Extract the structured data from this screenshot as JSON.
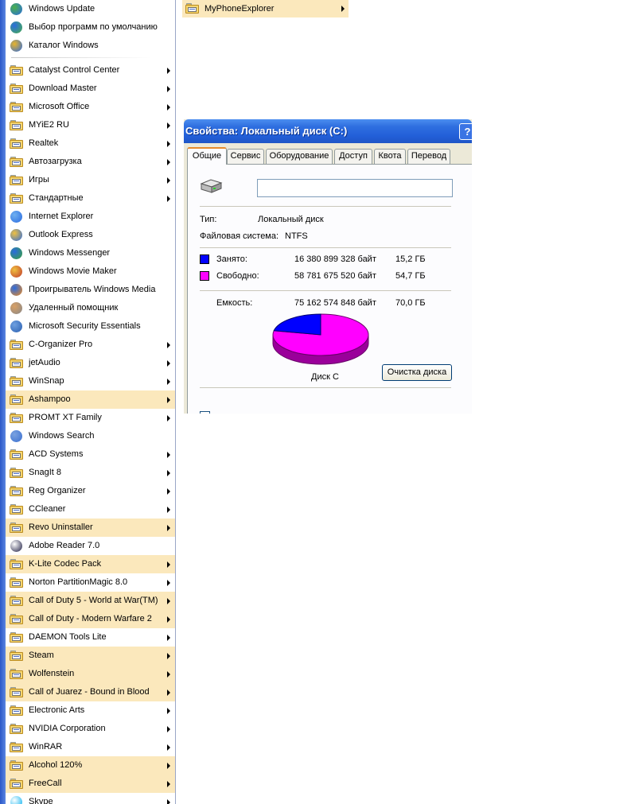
{
  "programs_menu": {
    "items": [
      {
        "label": "Windows Update",
        "icon": "windows-update-icon",
        "submenu": false,
        "highlighted": false
      },
      {
        "label": "Выбор программ по умолчанию",
        "icon": "default-programs-icon",
        "submenu": false,
        "highlighted": false
      },
      {
        "label": "Каталог Windows",
        "icon": "windows-catalog-icon",
        "submenu": false,
        "highlighted": false
      },
      {
        "label": "Catalyst Control Center",
        "icon": "folder-icon",
        "submenu": true,
        "highlighted": false
      },
      {
        "label": "Download Master",
        "icon": "folder-icon",
        "submenu": true,
        "highlighted": false
      },
      {
        "label": "Microsoft Office",
        "icon": "folder-icon",
        "submenu": true,
        "highlighted": false
      },
      {
        "label": "MYiE2 RU",
        "icon": "folder-icon",
        "submenu": true,
        "highlighted": false
      },
      {
        "label": "Realtek",
        "icon": "folder-icon",
        "submenu": true,
        "highlighted": false
      },
      {
        "label": "Автозагрузка",
        "icon": "folder-icon",
        "submenu": true,
        "highlighted": false
      },
      {
        "label": "Игры",
        "icon": "folder-icon",
        "submenu": true,
        "highlighted": false
      },
      {
        "label": "Стандартные",
        "icon": "folder-icon",
        "submenu": true,
        "highlighted": false
      },
      {
        "label": "Internet Explorer",
        "icon": "internet-explorer-icon",
        "submenu": false,
        "highlighted": false
      },
      {
        "label": "Outlook Express",
        "icon": "outlook-express-icon",
        "submenu": false,
        "highlighted": false
      },
      {
        "label": "Windows Messenger",
        "icon": "windows-messenger-icon",
        "submenu": false,
        "highlighted": false
      },
      {
        "label": "Windows Movie Maker",
        "icon": "movie-maker-icon",
        "submenu": false,
        "highlighted": false
      },
      {
        "label": "Проигрыватель Windows Media",
        "icon": "media-player-icon",
        "submenu": false,
        "highlighted": false
      },
      {
        "label": "Удаленный помощник",
        "icon": "remote-assistance-icon",
        "submenu": false,
        "highlighted": false
      },
      {
        "label": "Microsoft Security Essentials",
        "icon": "security-essentials-icon",
        "submenu": false,
        "highlighted": false
      },
      {
        "label": "C-Organizer Pro",
        "icon": "folder-icon",
        "submenu": true,
        "highlighted": false
      },
      {
        "label": "jetAudio",
        "icon": "folder-icon",
        "submenu": true,
        "highlighted": false
      },
      {
        "label": "WinSnap",
        "icon": "folder-icon",
        "submenu": true,
        "highlighted": false
      },
      {
        "label": "Ashampoo",
        "icon": "folder-icon",
        "submenu": true,
        "highlighted": true
      },
      {
        "label": "PROMT XT Family",
        "icon": "folder-icon",
        "submenu": true,
        "highlighted": false
      },
      {
        "label": "Windows Search",
        "icon": "windows-search-icon",
        "submenu": false,
        "highlighted": false
      },
      {
        "label": "ACD Systems",
        "icon": "folder-icon",
        "submenu": true,
        "highlighted": false
      },
      {
        "label": "SnagIt 8",
        "icon": "folder-icon",
        "submenu": true,
        "highlighted": false
      },
      {
        "label": "Reg Organizer",
        "icon": "folder-icon",
        "submenu": true,
        "highlighted": false
      },
      {
        "label": "CCleaner",
        "icon": "folder-icon",
        "submenu": true,
        "highlighted": false
      },
      {
        "label": "Revo Uninstaller",
        "icon": "folder-icon",
        "submenu": true,
        "highlighted": true
      },
      {
        "label": "Adobe Reader 7.0",
        "icon": "adobe-reader-icon",
        "submenu": false,
        "highlighted": false
      },
      {
        "label": "K-Lite Codec Pack",
        "icon": "folder-icon",
        "submenu": true,
        "highlighted": true
      },
      {
        "label": "Norton PartitionMagic 8.0",
        "icon": "folder-icon",
        "submenu": true,
        "highlighted": false
      },
      {
        "label": "Call of Duty 5 - World at War(TM)",
        "icon": "folder-icon",
        "submenu": true,
        "highlighted": true
      },
      {
        "label": "Call of Duty - Modern Warfare 2",
        "icon": "folder-icon",
        "submenu": true,
        "highlighted": true
      },
      {
        "label": "DAEMON Tools Lite",
        "icon": "folder-icon",
        "submenu": true,
        "highlighted": false
      },
      {
        "label": "Steam",
        "icon": "folder-icon",
        "submenu": true,
        "highlighted": true
      },
      {
        "label": "Wolfenstein",
        "icon": "folder-icon",
        "submenu": true,
        "highlighted": true
      },
      {
        "label": "Call of Juarez - Bound in Blood",
        "icon": "folder-icon",
        "submenu": true,
        "highlighted": true
      },
      {
        "label": "Electronic Arts",
        "icon": "folder-icon",
        "submenu": true,
        "highlighted": false
      },
      {
        "label": "NVIDIA Corporation",
        "icon": "folder-icon",
        "submenu": true,
        "highlighted": false
      },
      {
        "label": "WinRAR",
        "icon": "folder-icon",
        "submenu": true,
        "highlighted": false
      },
      {
        "label": "Alcohol 120%",
        "icon": "folder-icon",
        "submenu": true,
        "highlighted": true
      },
      {
        "label": "FreeCall",
        "icon": "folder-icon",
        "submenu": true,
        "highlighted": true
      },
      {
        "label": "Skype",
        "icon": "skype-icon",
        "submenu": true,
        "highlighted": false
      }
    ]
  },
  "submenu": {
    "label": "MyPhoneExplorer",
    "icon": "folder-icon"
  },
  "dialog": {
    "title": "Свойства: Локальный диск (C:)",
    "help": "?",
    "tabs": [
      "Общие",
      "Сервис",
      "Оборудование",
      "Доступ",
      "Квота",
      "Перевод"
    ],
    "active_tab": "Общие",
    "label_value": "",
    "type_label": "Тип:",
    "type_value": "Локальный диск",
    "fs_label": "Файловая система:",
    "fs_value": "NTFS",
    "used": {
      "label": "Занято:",
      "bytes": "16 380 899 328 байт",
      "size": "15,2 ГБ",
      "color": "#0000ff"
    },
    "free": {
      "label": "Свободно:",
      "bytes": "58 781 675 520 байт",
      "size": "54,7 ГБ",
      "color": "#ff00ff"
    },
    "capacity": {
      "label": "Емкость:",
      "bytes": "75 162 574 848 байт",
      "size": "70,0 ГБ"
    },
    "disk_label": "Диск C",
    "cleanup_button": "Очистка диска",
    "used_fraction": 0.218
  }
}
